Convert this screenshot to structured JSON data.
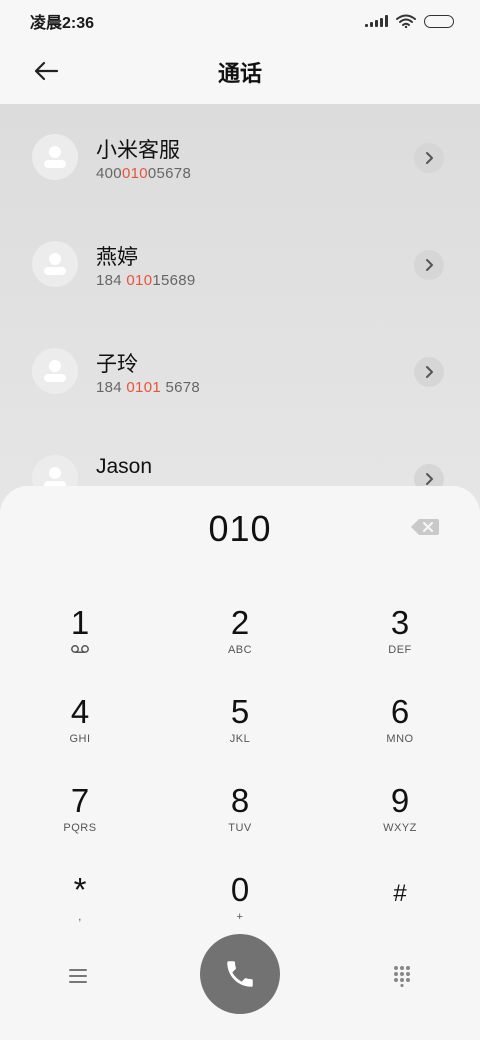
{
  "status_bar": {
    "time": "凌晨2:36",
    "icons": [
      "signal-icon",
      "wifi-icon",
      "battery-icon"
    ]
  },
  "header": {
    "title": "通话",
    "back_icon": "back-arrow-icon"
  },
  "contacts": [
    {
      "name": "小米客服",
      "number_parts": [
        "400",
        "010",
        "05678"
      ]
    },
    {
      "name": "燕婷",
      "number_parts": [
        "184 ",
        "010",
        "15689"
      ]
    },
    {
      "name": "子玲",
      "number_parts": [
        "184 ",
        "0101",
        " 5678"
      ]
    },
    {
      "name": "Jason",
      "number_parts": [
        "",
        "",
        ""
      ]
    }
  ],
  "dialpad": {
    "input_value": "010",
    "keys": [
      {
        "digit": "1",
        "letters": "voicemail-icon"
      },
      {
        "digit": "2",
        "letters": "ABC"
      },
      {
        "digit": "3",
        "letters": "DEF"
      },
      {
        "digit": "4",
        "letters": "GHI"
      },
      {
        "digit": "5",
        "letters": "JKL"
      },
      {
        "digit": "6",
        "letters": "MNO"
      },
      {
        "digit": "7",
        "letters": "PQRS"
      },
      {
        "digit": "8",
        "letters": "TUV"
      },
      {
        "digit": "9",
        "letters": "WXYZ"
      },
      {
        "digit": "*",
        "letters": ","
      },
      {
        "digit": "0",
        "letters": "+"
      },
      {
        "digit": "#",
        "letters": ""
      }
    ]
  },
  "colors": {
    "highlight": "#e8543a",
    "call_button": "#727272",
    "list_background": "#e2e2e2",
    "page_background": "#f7f7f7"
  }
}
